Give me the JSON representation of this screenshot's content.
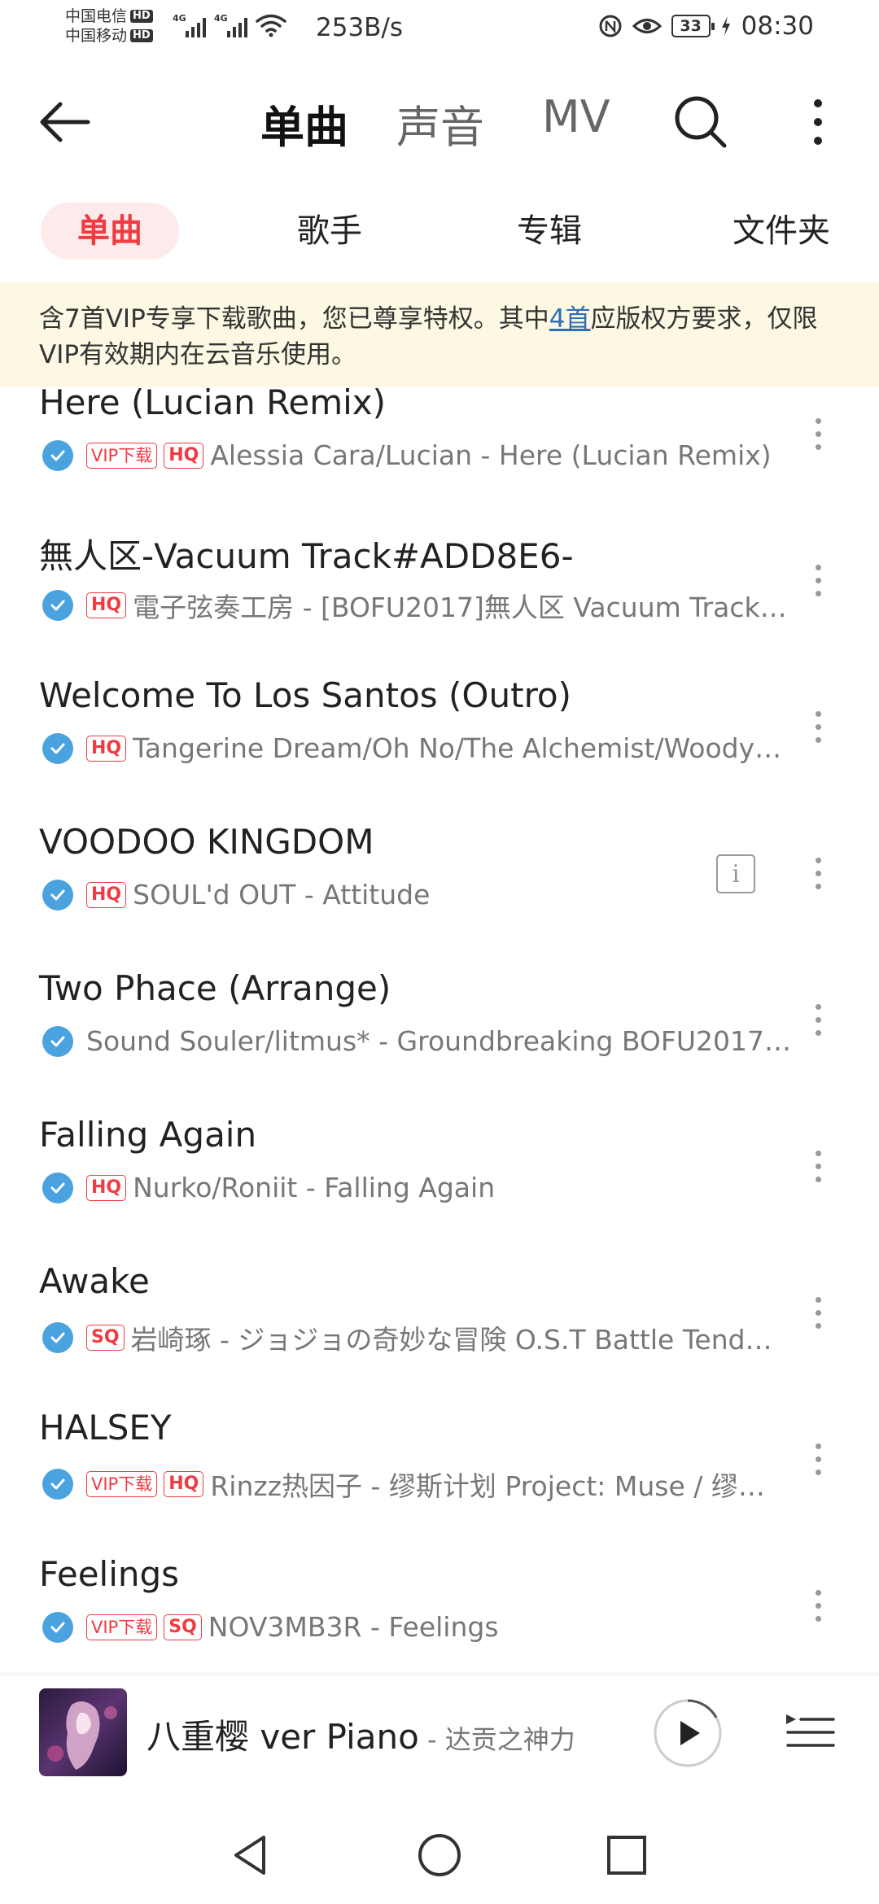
{
  "status_bar": {
    "carrier1": "中国电信",
    "carrier2": "中国移动",
    "hd": "HD",
    "net_type": "4G",
    "net_speed": "253B/s",
    "battery": "33",
    "time": "08:30"
  },
  "top_nav": {
    "tabs": [
      "单曲",
      "声音",
      "MV"
    ],
    "active_tab": "单曲"
  },
  "sub_tabs": {
    "items": [
      "单曲",
      "歌手",
      "专辑",
      "文件夹"
    ],
    "active": "单曲"
  },
  "notice": {
    "prefix": "含7首VIP专享下载歌曲，您已尊享特权。其中",
    "link": "4首",
    "suffix": "应版权方要求，仅限VIP有效期内在云音乐使用。"
  },
  "songs": [
    {
      "title": "Here (Lucian Remix)",
      "vip": "VIP下载",
      "quality": "HQ",
      "subtitle": "Alessia Cara/Lucian - Here (Lucian Remix)"
    },
    {
      "title": "無人区-Vacuum Track#ADD8E6-",
      "vip": null,
      "quality": "HQ",
      "subtitle": "電子弦奏工房 - [BOFU2017]無人区 Vacuum Track…"
    },
    {
      "title": "Welcome To Los Santos (Outro)",
      "vip": null,
      "quality": "HQ",
      "subtitle": "Tangerine Dream/Oh No/The Alchemist/Woody…"
    },
    {
      "title": "VOODOO KINGDOM",
      "vip": null,
      "quality": "HQ",
      "subtitle": "SOUL'd OUT - Attitude"
    },
    {
      "title": "Two Phace (Arrange)",
      "vip": null,
      "quality": null,
      "subtitle": "Sound Souler/litmus* - Groundbreaking  BOFU2017…"
    },
    {
      "title": "Falling Again",
      "vip": null,
      "quality": "HQ",
      "subtitle": "Nurko/Roniit - Falling Again"
    },
    {
      "title": "Awake",
      "vip": null,
      "quality": "SQ",
      "subtitle": "岩崎琢 - ジョジョの奇妙な冒険 O.S.T Battle Tend…"
    },
    {
      "title": "HALSEY",
      "vip": "VIP下载",
      "quality": "HQ",
      "subtitle": "Rinzz热因子 - 缪斯计划 Project: Muse / 缪…"
    },
    {
      "title": "Feelings",
      "vip": "VIP下载",
      "quality": "SQ",
      "subtitle": "NOV3MB3R - Feelings"
    }
  ],
  "now_playing": {
    "title": "八重樱 ver Piano",
    "separator": " - ",
    "artist": "达贡之神力"
  },
  "colors": {
    "accent": "#ef3b42",
    "notice_bg": "#fdf8e3",
    "check": "#4aa3df",
    "link": "#2d6eb5"
  },
  "icons": {
    "back": "arrow-left-icon",
    "search": "search-icon",
    "more": "more-vertical-icon",
    "check": "check-circle-icon",
    "info": "info-icon",
    "play": "play-icon",
    "playlist": "playlist-icon",
    "nav_back": "triangle-back-icon",
    "nav_home": "circle-home-icon",
    "nav_recent": "square-recent-icon"
  }
}
